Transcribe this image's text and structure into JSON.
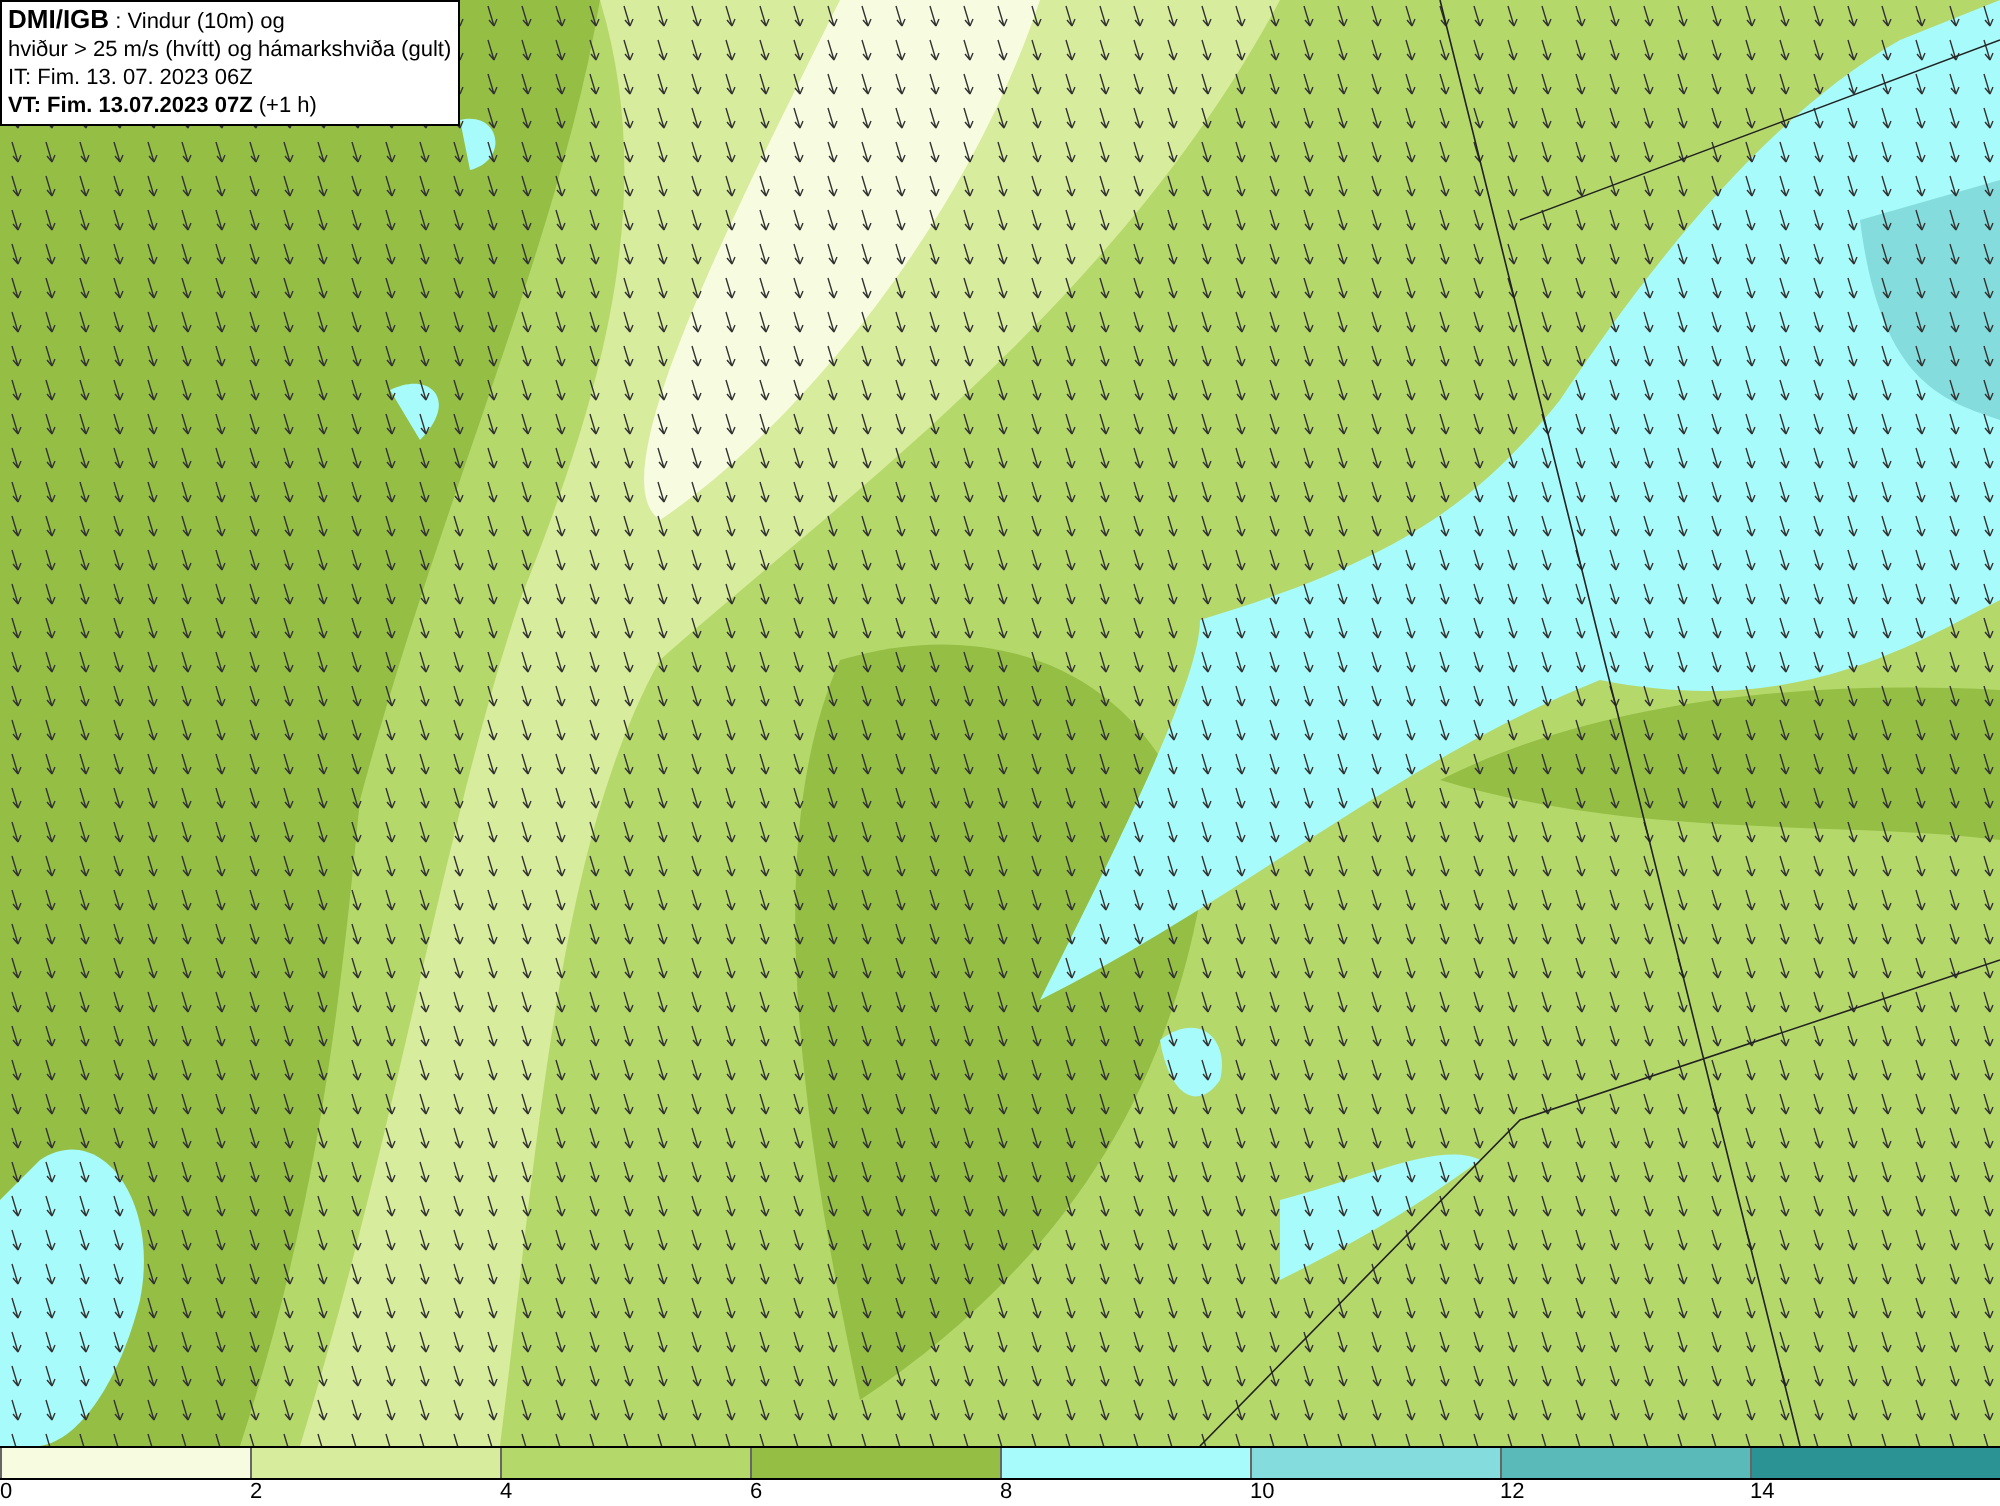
{
  "info_box": {
    "lines": [
      "**DMI/IGB** : Vindur (10m) og",
      "hviður > 25 m/s (hvítt) og hámarkshviða (gult)",
      "IT: Fim. 13. 07. 2023 06Z",
      "**VT: Fim. 13.07.2023 07Z** (+1 h)"
    ]
  },
  "legend": [
    {
      "color": "#f7fbe0",
      "label": "0"
    },
    {
      "color": "#d7ec9c",
      "label": "2"
    },
    {
      "color": "#b5d86b",
      "label": "4"
    },
    {
      "color": "#94be44",
      "label": "6"
    },
    {
      "color": "#a8fbfb",
      "label": "8"
    },
    {
      "color": "#84dcdc",
      "label": "10"
    },
    {
      "color": "#5ab9b9",
      "label": "12"
    },
    {
      "color": "#2b9393",
      "label": "14"
    }
  ]
}
